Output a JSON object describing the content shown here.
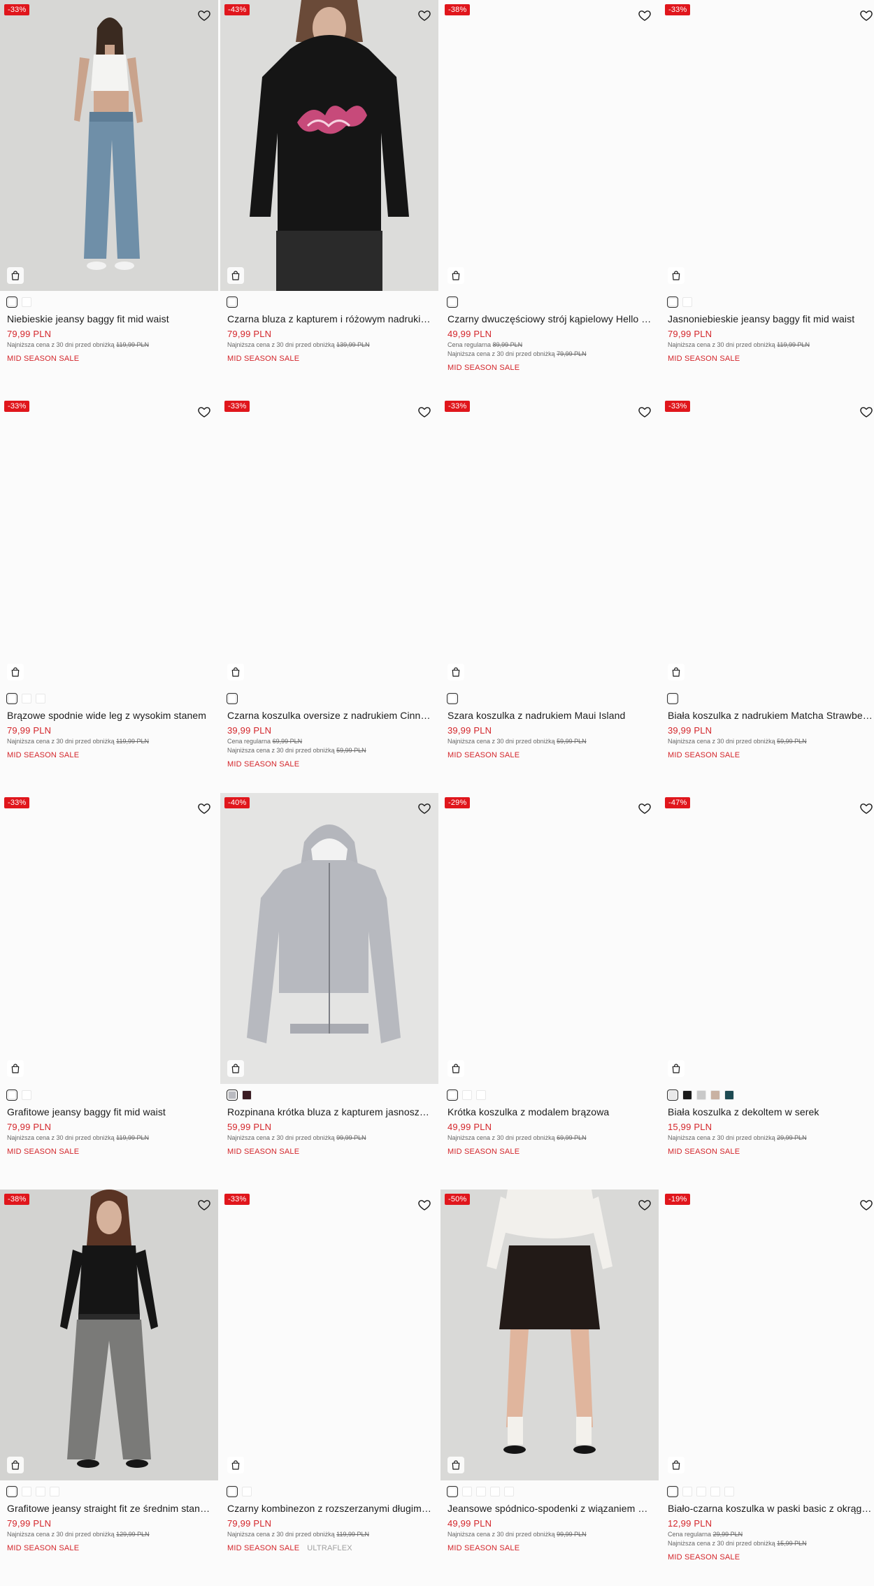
{
  "colors": {
    "accent": "#d4262b",
    "badge": "#e0161c"
  },
  "icons": {
    "wishlist": "heart-icon",
    "add_to_cart": "shopping-bag-icon"
  },
  "products": [
    {
      "badge": "-33%",
      "name": "Niebieskie jeansy baggy fit mid waist",
      "price": "79,99 PLN",
      "regular_label": "",
      "regular_price": "",
      "lowest_label": "Najniższa cena z 30 dni przed obniżką",
      "lowest_price": "119,99 PLN",
      "sale": "MID SEASON SALE",
      "extra_tag": "",
      "swatches": [
        "#ffffff",
        "#ffffff"
      ],
      "image": "jeans-top"
    },
    {
      "badge": "-43%",
      "name": "Czarna bluza z kapturem i różowym nadrukiem",
      "price": "79,99 PLN",
      "regular_label": "",
      "regular_price": "",
      "lowest_label": "Najniższa cena z 30 dni przed obniżką",
      "lowest_price": "139,99 PLN",
      "sale": "MID SEASON SALE",
      "extra_tag": "",
      "swatches": [
        "#ffffff"
      ],
      "image": "hoodie-black"
    },
    {
      "badge": "-38%",
      "name": "Czarny dwuczęściowy strój kąpielowy Hello Kitty",
      "price": "49,99 PLN",
      "regular_label": "Cena regularna",
      "regular_price": "89,99 PLN",
      "lowest_label": "Najniższa cena z 30 dni przed obniżką",
      "lowest_price": "79,99 PLN",
      "sale": "MID SEASON SALE",
      "extra_tag": "",
      "swatches": [
        "#ffffff"
      ],
      "image": ""
    },
    {
      "badge": "-33%",
      "name": "Jasnoniebieskie jeansy baggy fit mid waist",
      "price": "79,99 PLN",
      "regular_label": "",
      "regular_price": "",
      "lowest_label": "Najniższa cena z 30 dni przed obniżką",
      "lowest_price": "119,99 PLN",
      "sale": "MID SEASON SALE",
      "extra_tag": "",
      "swatches": [
        "#ffffff",
        "#ffffff"
      ],
      "image": ""
    },
    {
      "badge": "-33%",
      "name": "Brązowe spodnie wide leg z wysokim stanem",
      "price": "79,99 PLN",
      "regular_label": "",
      "regular_price": "",
      "lowest_label": "Najniższa cena z 30 dni przed obniżką",
      "lowest_price": "119,99 PLN",
      "sale": "MID SEASON SALE",
      "extra_tag": "",
      "swatches": [
        "#ffffff",
        "#ffffff",
        "#ffffff"
      ],
      "image": ""
    },
    {
      "badge": "-33%",
      "name": "Czarna koszulka oversize z nadrukiem Cinnamoroll",
      "price": "39,99 PLN",
      "regular_label": "Cena regularna",
      "regular_price": "69,99 PLN",
      "lowest_label": "Najniższa cena z 30 dni przed obniżką",
      "lowest_price": "59,99 PLN",
      "sale": "MID SEASON SALE",
      "extra_tag": "",
      "swatches": [
        "#ffffff"
      ],
      "image": ""
    },
    {
      "badge": "-33%",
      "name": "Szara koszulka z nadrukiem Maui Island",
      "price": "39,99 PLN",
      "regular_label": "",
      "regular_price": "",
      "lowest_label": "Najniższa cena z 30 dni przed obniżką",
      "lowest_price": "59,99 PLN",
      "sale": "MID SEASON SALE",
      "extra_tag": "",
      "swatches": [
        "#ffffff"
      ],
      "image": ""
    },
    {
      "badge": "-33%",
      "name": "Biała koszulka z nadrukiem Matcha Strawberry",
      "price": "39,99 PLN",
      "regular_label": "",
      "regular_price": "",
      "lowest_label": "Najniższa cena z 30 dni przed obniżką",
      "lowest_price": "59,99 PLN",
      "sale": "MID SEASON SALE",
      "extra_tag": "",
      "swatches": [
        "#ffffff"
      ],
      "image": ""
    },
    {
      "badge": "-33%",
      "name": "Grafitowe jeansy baggy fit mid waist",
      "price": "79,99 PLN",
      "regular_label": "",
      "regular_price": "",
      "lowest_label": "Najniższa cena z 30 dni przed obniżką",
      "lowest_price": "119,99 PLN",
      "sale": "MID SEASON SALE",
      "extra_tag": "",
      "swatches": [
        "#ffffff",
        "#ffffff"
      ],
      "image": ""
    },
    {
      "badge": "-40%",
      "name": "Rozpinana krótka bluza z kapturem jasnoszara",
      "price": "59,99 PLN",
      "regular_label": "",
      "regular_price": "",
      "lowest_label": "Najniższa cena z 30 dni przed obniżką",
      "lowest_price": "99,99 PLN",
      "sale": "MID SEASON SALE",
      "extra_tag": "",
      "swatches": [
        "#b9bac0",
        "#3a1b22"
      ],
      "image": "hoodie-grey"
    },
    {
      "badge": "-29%",
      "name": "Krótka koszulka z modalem brązowa",
      "price": "49,99 PLN",
      "regular_label": "",
      "regular_price": "",
      "lowest_label": "Najniższa cena z 30 dni przed obniżką",
      "lowest_price": "69,99 PLN",
      "sale": "MID SEASON SALE",
      "extra_tag": "",
      "swatches": [
        "#ffffff",
        "#ffffff",
        "#ffffff"
      ],
      "image": ""
    },
    {
      "badge": "-47%",
      "name": "Biała koszulka z dekoltem w serek",
      "price": "15,99 PLN",
      "regular_label": "",
      "regular_price": "",
      "lowest_label": "Najniższa cena z 30 dni przed obniżką",
      "lowest_price": "29,99 PLN",
      "sale": "MID SEASON SALE",
      "extra_tag": "",
      "swatches": [
        "#e9e9ea",
        "#1b1b1b",
        "#c9c9c9",
        "#c9b2a3",
        "#1d4a52"
      ],
      "image": ""
    },
    {
      "badge": "-38%",
      "name": "Grafitowe jeansy straight fit ze średnim stanem",
      "price": "79,99 PLN",
      "regular_label": "",
      "regular_price": "",
      "lowest_label": "Najniższa cena z 30 dni przed obniżką",
      "lowest_price": "129,99 PLN",
      "sale": "MID SEASON SALE",
      "extra_tag": "",
      "swatches": [
        "#ffffff",
        "#ffffff",
        "#ffffff",
        "#ffffff"
      ],
      "image": "jeans-grey"
    },
    {
      "badge": "-33%",
      "name": "Czarny kombinezon z rozszerzanymi długimi nogawkami",
      "price": "79,99 PLN",
      "regular_label": "",
      "regular_price": "",
      "lowest_label": "Najniższa cena z 30 dni przed obniżką",
      "lowest_price": "119,99 PLN",
      "sale": "MID SEASON SALE",
      "extra_tag": "ULTRAFLEX",
      "swatches": [
        "#ffffff",
        "#ffffff"
      ],
      "image": ""
    },
    {
      "badge": "-50%",
      "name": "Jeansowe spódnico-spodenki z wiązaniem czarne",
      "price": "49,99 PLN",
      "regular_label": "",
      "regular_price": "",
      "lowest_label": "Najniższa cena z 30 dni przed obniżką",
      "lowest_price": "99,99 PLN",
      "sale": "MID SEASON SALE",
      "extra_tag": "",
      "swatches": [
        "#ffffff",
        "#ffffff",
        "#ffffff",
        "#ffffff",
        "#ffffff"
      ],
      "image": "skirt"
    },
    {
      "badge": "-19%",
      "name": "Biało-czarna koszulka w paski basic z okrągłym dekoltem",
      "price": "12,99 PLN",
      "regular_label": "Cena regularna",
      "regular_price": "29,99 PLN",
      "lowest_label": "Najniższa cena z 30 dni przed obniżką",
      "lowest_price": "15,99 PLN",
      "sale": "MID SEASON SALE",
      "extra_tag": "",
      "swatches": [
        "#ffffff",
        "#ffffff",
        "#ffffff",
        "#ffffff",
        "#ffffff"
      ],
      "image": ""
    }
  ]
}
